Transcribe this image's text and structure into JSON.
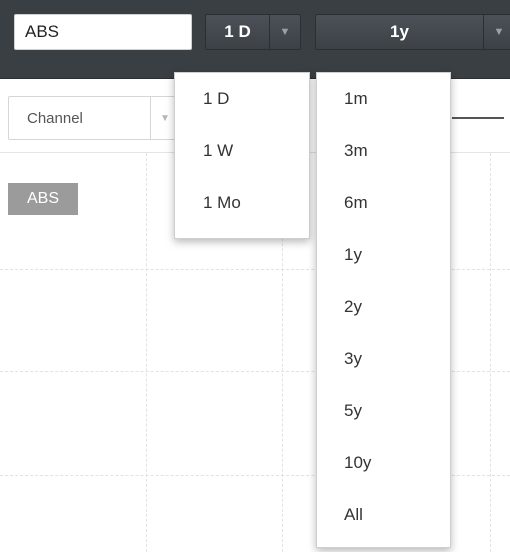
{
  "toolbar": {
    "symbol_value": "ABS",
    "interval_label": "1 D",
    "range_label": "1y"
  },
  "controls": {
    "channel_label": "Channel"
  },
  "chart": {
    "series_tag": "ABS"
  },
  "interval_menu": {
    "items": [
      "1 D",
      "1 W",
      "1 Mo"
    ]
  },
  "range_menu": {
    "items": [
      "1m",
      "3m",
      "6m",
      "1y",
      "2y",
      "3y",
      "5y",
      "10y",
      "All"
    ]
  },
  "colors": {
    "toolbar_bg": "#3a3f44",
    "tag_bg": "#9b9b9b"
  }
}
